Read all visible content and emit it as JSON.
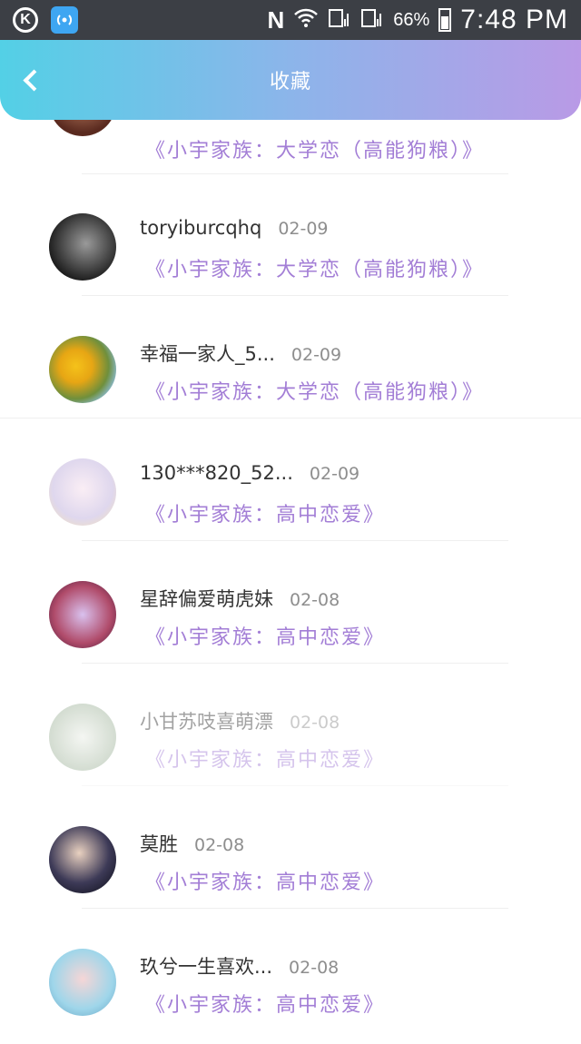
{
  "status_bar": {
    "network_label": "N",
    "battery_percent": "66%",
    "time": "7:48 PM"
  },
  "header": {
    "title": "收藏"
  },
  "list": [
    {
      "name": "",
      "date": "",
      "work": "《小宇家族：大学恋（高能狗粮）》"
    },
    {
      "name": "toryiburcqhq",
      "date": "02-09",
      "work": "《小宇家族：大学恋（高能狗粮）》"
    },
    {
      "name": "幸福一家人_5...",
      "date": "02-09",
      "work": "《小宇家族：大学恋（高能狗粮）》"
    },
    {
      "name": "130***820_52...",
      "date": "02-09",
      "work": "《小宇家族：高中恋爱》"
    },
    {
      "name": "星辞偏爱萌虎妹",
      "date": "02-08",
      "work": "《小宇家族：高中恋爱》"
    },
    {
      "name": "小甘苏吱喜萌漂",
      "date": "02-08",
      "work": "《小宇家族：高中恋爱》"
    },
    {
      "name": "莫胜",
      "date": "02-08",
      "work": "《小宇家族：高中恋爱》"
    },
    {
      "name": "玖兮一生喜欢...",
      "date": "02-08",
      "work": "《小宇家族：高中恋爱》"
    }
  ],
  "colors": {
    "accent": "#a37ed6",
    "header_start": "#53d0e6",
    "header_end": "#b99ae6"
  }
}
